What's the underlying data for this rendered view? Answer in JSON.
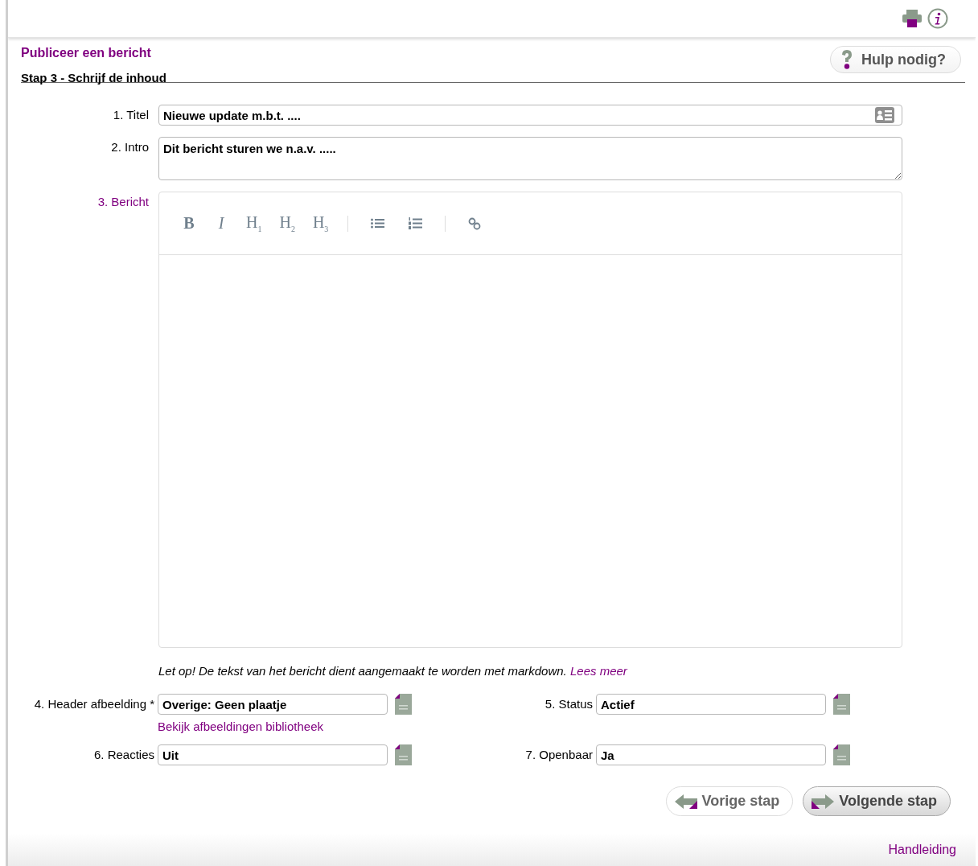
{
  "header": {
    "title": "Publiceer een bericht",
    "step": "Stap 3 - Schrijf de inhoud",
    "help_button": "Hulp nodig?"
  },
  "fields": [
    {
      "label": "1. Titel",
      "kind": "text",
      "value": "Nieuwe update m.b.t. ....",
      "focused": false
    },
    {
      "label": "2. Intro",
      "kind": "textarea",
      "value": "Dit bericht sturen we n.a.v. .....",
      "focused": false
    },
    {
      "label": "3. Bericht",
      "kind": "editor",
      "focused": true,
      "toolbar": [
        {
          "kind": "bold",
          "label": "B"
        },
        {
          "kind": "italic",
          "label": "I"
        },
        {
          "kind": "heading",
          "label": "H$_{1}$"
        },
        {
          "kind": "heading",
          "label": "H$_{2}$"
        },
        {
          "kind": "heading",
          "label": "H$_{3}$"
        },
        {
          "kind": "separator"
        },
        {
          "kind": "bullet-list"
        },
        {
          "kind": "numbered-list"
        },
        {
          "kind": "separator"
        },
        {
          "kind": "link"
        }
      ]
    }
  ],
  "note": {
    "text": "Let op! De tekst van het bericht dient aangemaakt te worden met markdown.",
    "link": "Lees meer"
  },
  "options": [
    {
      "label": "4. Header afbeelding *",
      "value": "Overige: Geen plaatje",
      "link": "Bekijk afbeeldingen bibliotheek"
    },
    {
      "label": "5. Status",
      "value": "Actief"
    },
    {
      "label": "6. Reacties",
      "value": "Uit"
    },
    {
      "label": "7. Openbaar",
      "value": "Ja"
    }
  ],
  "buttons": [
    {
      "label": "Vorige stap",
      "kind": "previous"
    },
    {
      "label": "Volgende stap",
      "kind": "next"
    }
  ],
  "footer": {
    "link": "Handleiding"
  }
}
